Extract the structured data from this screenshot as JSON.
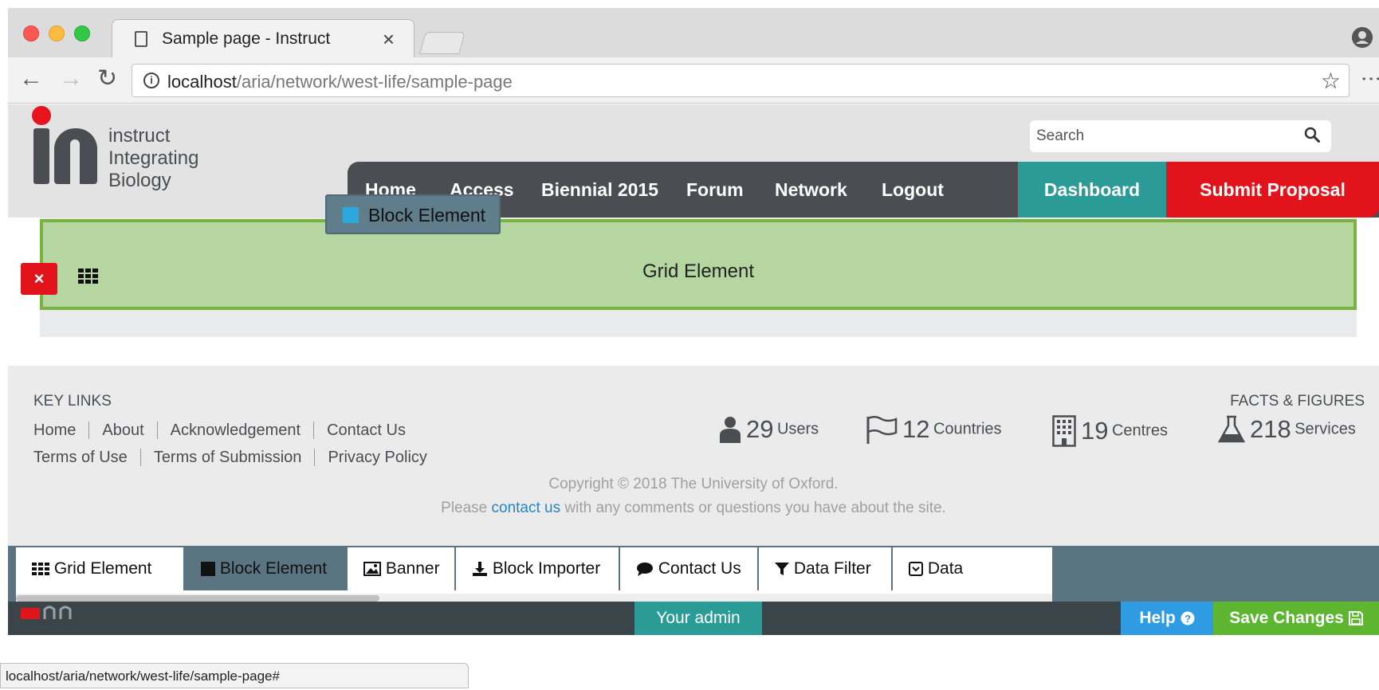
{
  "browser": {
    "tab_title": "Sample page - Instruct",
    "tab_close": "×",
    "url_host": "localhost",
    "url_path": "/aria/network/west-life/sample-page",
    "status_url": "localhost/aria/network/west-life/sample-page#"
  },
  "header": {
    "logo_lines": [
      "instruct",
      "Integrating",
      "Biology"
    ],
    "search_placeholder": "Search",
    "nav": [
      "Home",
      "Access",
      "Biennial 2015",
      "Forum",
      "Network",
      "Logout"
    ],
    "dashboard": "Dashboard",
    "submit_proposal": "Submit Proposal"
  },
  "canvas": {
    "grid_label": "Grid Element",
    "remove_label": "×",
    "drag_block_label": "Block Element"
  },
  "footer": {
    "key_links_title": "KEY LINKS",
    "links_row1": [
      "Home",
      "About",
      "Acknowledgement",
      "Contact Us"
    ],
    "links_row2": [
      "Terms of Use",
      "Terms of Submission",
      "Privacy Policy"
    ],
    "facts_title": "FACTS & FIGURES",
    "facts": [
      {
        "num": "29",
        "unit": "Users",
        "icon": "user-icon"
      },
      {
        "num": "12",
        "unit": "Countries",
        "icon": "flag-icon"
      },
      {
        "num": "19",
        "unit": "Centres",
        "icon": "building-icon"
      },
      {
        "num": "218",
        "unit": "Services",
        "icon": "flask-icon"
      }
    ],
    "copyright": "Copyright © 2018 The University of Oxford.",
    "contact_pre": "Please ",
    "contact_link": "contact us",
    "contact_post": " with any comments or questions you have about the site."
  },
  "palette": {
    "items": [
      {
        "label": "Grid Element",
        "icon": "grid-icon"
      },
      {
        "label": "Block Element",
        "icon": "square-icon"
      },
      {
        "label": "Banner",
        "icon": "image-icon"
      },
      {
        "label": "Block Importer",
        "icon": "download-icon"
      },
      {
        "label": "Contact Us",
        "icon": "comment-icon"
      },
      {
        "label": "Data Filter",
        "icon": "filter-icon"
      },
      {
        "label": "Data",
        "icon": "box-icon"
      }
    ]
  },
  "admin": {
    "your_admin": "Your admin",
    "help": "Help",
    "save": "Save Changes"
  },
  "colors": {
    "brand_red": "#e3131b",
    "teal": "#2a9b96",
    "grid_green": "#b5d6a0",
    "save_green": "#5db530",
    "help_blue": "#2f9be3"
  }
}
